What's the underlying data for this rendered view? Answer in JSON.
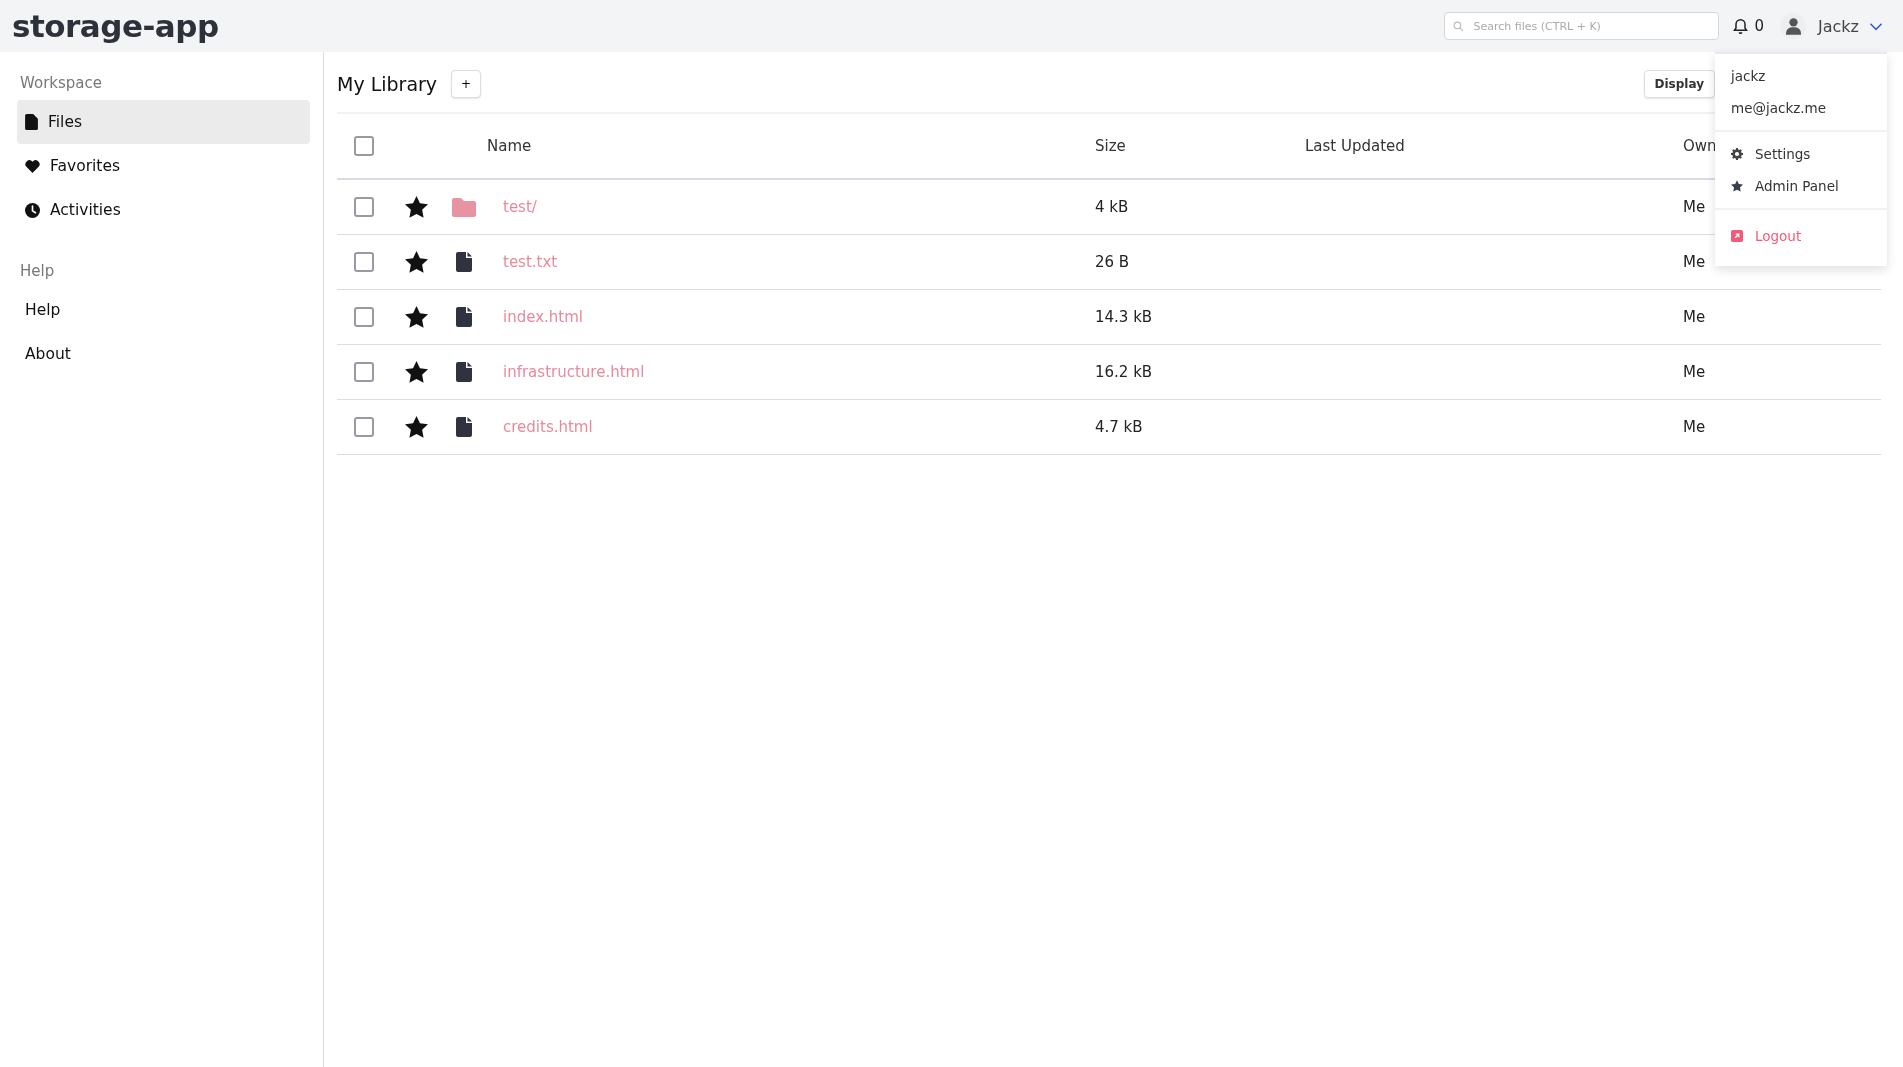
{
  "app_title": "storage-app",
  "topbar": {
    "search": {
      "placeholder": "Search files (CTRL + K)"
    },
    "notification_count": "0",
    "user_name": "Jackz"
  },
  "sidebar": {
    "sections": [
      {
        "heading": "Workspace",
        "items": [
          {
            "label": "Files",
            "kind": "files",
            "selected": true
          },
          {
            "label": "Favorites",
            "kind": "favorites",
            "selected": false
          },
          {
            "label": "Activities",
            "kind": "activities",
            "selected": false
          }
        ]
      },
      {
        "heading": "Help",
        "items": [
          {
            "label": "Help",
            "kind": "plain",
            "selected": false
          },
          {
            "label": "About",
            "kind": "plain",
            "selected": false
          }
        ]
      }
    ]
  },
  "library": {
    "title": "My Library",
    "add_button": "+",
    "display_button": "Display"
  },
  "table": {
    "columns": [
      "Name",
      "Size",
      "Last Updated",
      "Own"
    ],
    "select_all_checked": false,
    "rows": [
      {
        "kind": "folder",
        "name": "test/",
        "size": "4 kB",
        "owner": "Me",
        "checked": false,
        "starred": true
      },
      {
        "kind": "file",
        "name": "test.txt",
        "size": "26 B",
        "owner": "Me",
        "checked": false,
        "starred": true
      },
      {
        "kind": "file",
        "name": "index.html",
        "size": "14.3 kB",
        "owner": "Me",
        "checked": false,
        "starred": true
      },
      {
        "kind": "file",
        "name": "infrastructure.html",
        "size": "16.2 kB",
        "owner": "Me",
        "checked": false,
        "starred": true
      },
      {
        "kind": "file",
        "name": "credits.html",
        "size": "4.7 kB",
        "owner": "Me",
        "checked": false,
        "starred": true
      }
    ]
  },
  "user_menu": {
    "username": "jackz",
    "email": "me@jackz.me",
    "items": [
      {
        "kind": "settings",
        "label": "Settings"
      },
      {
        "kind": "admin",
        "label": "Admin Panel"
      },
      {
        "kind": "logout",
        "label": "Logout"
      }
    ]
  }
}
